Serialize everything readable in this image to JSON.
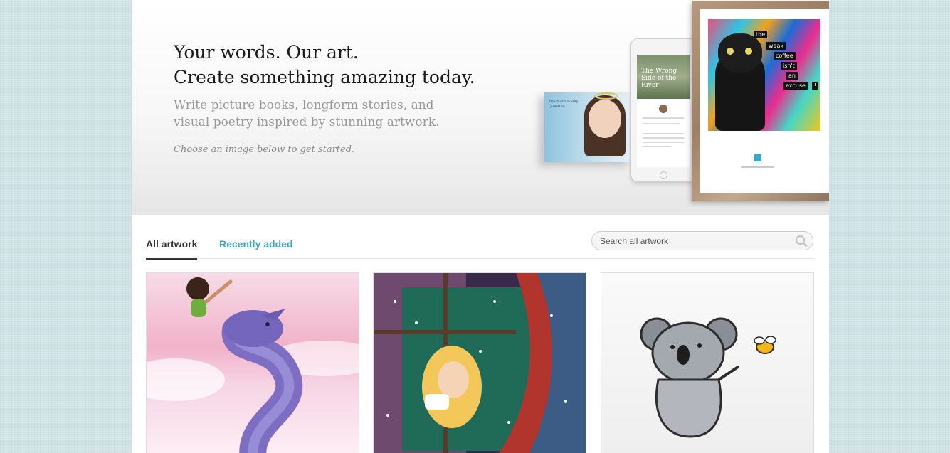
{
  "hero": {
    "title_line1": "Your words. Our art.",
    "title_line2": "Create something amazing today.",
    "subtitle": "Write picture books, longform stories, and visual poetry inspired by stunning artwork.",
    "cta": "Choose an image below to get started.",
    "book_title": "The Not-So-Silly Question",
    "tablet_title": "The Wrong Side of the River",
    "frame_words": [
      "the",
      "weak",
      "coffee",
      "isn't",
      "an",
      "excuse",
      "!"
    ]
  },
  "tabs": [
    {
      "label": "All artwork",
      "active": true
    },
    {
      "label": "Recently added",
      "active": false
    }
  ],
  "search": {
    "placeholder": "Search all artwork"
  },
  "artwork": [
    {
      "description": "girl riding purple dragon"
    },
    {
      "description": "girl with teacup at snowy window"
    },
    {
      "description": "koala and bee watercolor"
    }
  ],
  "colors": {
    "accent": "#3fa3bf",
    "page_bg": "#cfe2e6",
    "text_dark": "#1a1a1a",
    "text_muted": "#999999"
  }
}
